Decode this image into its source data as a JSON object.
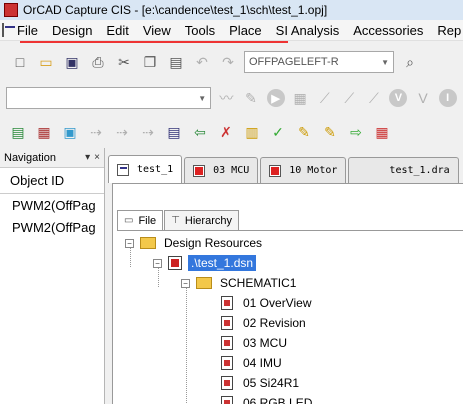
{
  "window": {
    "title": "OrCAD Capture CIS - [e:\\candence\\test_1\\sch\\test_1.opj]"
  },
  "menubar": {
    "items": [
      "File",
      "Design",
      "Edit",
      "View",
      "Tools",
      "Place",
      "SI Analysis",
      "Accessories",
      "Rep"
    ]
  },
  "toolbar": {
    "page_combo_value": "OFFPAGELEFT-R",
    "part_combo_value": ""
  },
  "navigation": {
    "title": "Navigation",
    "controls": [
      "▾",
      "×"
    ],
    "column_header": "Object ID",
    "rows": [
      "PWM2(OffPag",
      "PWM2(OffPag"
    ]
  },
  "doc_tabs": [
    {
      "label": "test_1",
      "icon": "schematic-doc-icon",
      "active": true
    },
    {
      "label": "03 MCU",
      "icon": "page-icon",
      "active": false
    },
    {
      "label": "10 Motor",
      "icon": "page-icon",
      "active": false
    },
    {
      "label": "test_1.dra",
      "icon": "drawing-icon",
      "active": false
    }
  ],
  "project": {
    "tabs": [
      {
        "label": "File",
        "active": true
      },
      {
        "label": "Hierarchy",
        "active": false
      }
    ],
    "tree": {
      "root": "Design Resources",
      "design_file": ".\\test_1.dsn",
      "schematic": "SCHEMATIC1",
      "pages": [
        "01 OverView",
        "02 Revision",
        "03 MCU",
        "04 IMU",
        "05 Si24R1",
        "06 RGB LED"
      ]
    }
  },
  "colors": {
    "selection": "#3377dd",
    "annotation_underline": "#e33333",
    "folder": "#f3c84a"
  }
}
